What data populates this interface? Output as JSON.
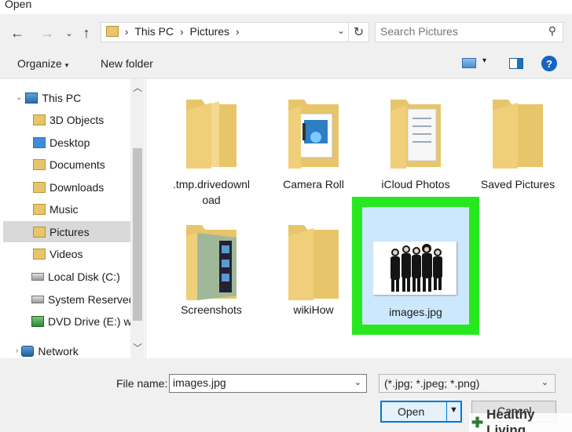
{
  "window": {
    "title": "Open"
  },
  "nav": {
    "crumbs": [
      "This PC",
      "Pictures"
    ],
    "search_placeholder": "Search Pictures"
  },
  "toolbar": {
    "organize": "Organize",
    "new_folder": "New folder",
    "help": "?"
  },
  "sidebar": {
    "items": [
      {
        "label": "This PC",
        "icon": "pc-icon"
      },
      {
        "label": "3D Objects",
        "icon": "folder-icon"
      },
      {
        "label": "Desktop",
        "icon": "folder-icon"
      },
      {
        "label": "Documents",
        "icon": "folder-icon"
      },
      {
        "label": "Downloads",
        "icon": "download-folder-icon"
      },
      {
        "label": "Music",
        "icon": "music-folder-icon"
      },
      {
        "label": "Pictures",
        "icon": "pictures-folder-icon",
        "selected": true
      },
      {
        "label": "Videos",
        "icon": "videos-folder-icon"
      },
      {
        "label": "Local Disk (C:)",
        "icon": "disk-icon"
      },
      {
        "label": "System Reserved",
        "icon": "disk-icon"
      },
      {
        "label": "DVD Drive (E:) w",
        "icon": "dvd-icon"
      },
      {
        "label": "Network",
        "icon": "network-icon"
      }
    ]
  },
  "files": [
    {
      "name": ".tmp.drivedownl",
      "name2": "oad",
      "kind": "folder"
    },
    {
      "name": "Camera Roll",
      "kind": "folder-media"
    },
    {
      "name": "iCloud Photos",
      "kind": "folder-docs"
    },
    {
      "name": "Saved Pictures",
      "kind": "folder"
    },
    {
      "name": "Screenshots",
      "kind": "folder-screens"
    },
    {
      "name": "wikiHow",
      "kind": "folder"
    },
    {
      "name": "images.jpg",
      "kind": "image",
      "selected": true
    }
  ],
  "bottom": {
    "file_name_label": "File name:",
    "file_name_value": "images.jpg",
    "filter": "(*.jpg; *.jpeg; *.png)",
    "open": "Open",
    "cancel": "Cancel"
  },
  "watermark": {
    "text": "Healthy Living"
  },
  "colors": {
    "accent": "#0078d7",
    "selection_highlight": "#27e81f",
    "folder": "#f0cf7a"
  }
}
